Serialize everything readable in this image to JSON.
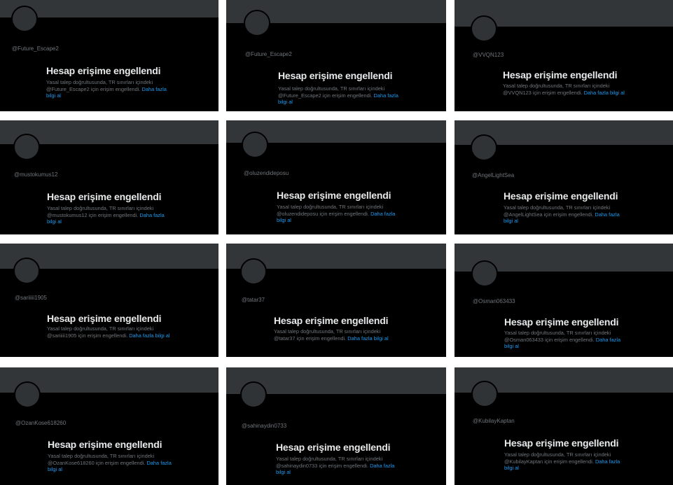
{
  "common": {
    "title": "Hesap erişime engellendi",
    "desc_prefix": "Yasal talep doğrultusunda, TR sınırları içindeki",
    "desc_suffix": "için erişim engellendi.",
    "link": "Daha fazla bilgi al"
  },
  "cards": [
    {
      "handle": "@Future_Escape2",
      "desc_handle": "@Future_Escape2"
    },
    {
      "handle": "@Future_Escape2",
      "desc_handle": "@Future_Escape2"
    },
    {
      "handle": "@VVQN123",
      "desc_handle": "@VVQN123"
    },
    {
      "handle": "@mustokumus12",
      "desc_handle": "@mustokumus12"
    },
    {
      "handle": "@oluzendideposu",
      "desc_handle": "@oluzendideposu"
    },
    {
      "handle": "@AngelLightSea",
      "desc_handle": "@AngelLightSea"
    },
    {
      "handle": "@sariiiii1905",
      "desc_handle": "@sariiiii1905"
    },
    {
      "handle": "@tatar37",
      "desc_handle": "@tatar37"
    },
    {
      "handle": "@Osman063433",
      "desc_handle": "@Osman063433"
    },
    {
      "handle": "@OzanKose618260",
      "desc_handle": "@OzanKose618260"
    },
    {
      "handle": "@sahinaydin0733",
      "desc_handle": "@sahinaydin0733"
    },
    {
      "handle": "@KubilayKaptan",
      "desc_handle": "@KubilayKaptan"
    }
  ]
}
